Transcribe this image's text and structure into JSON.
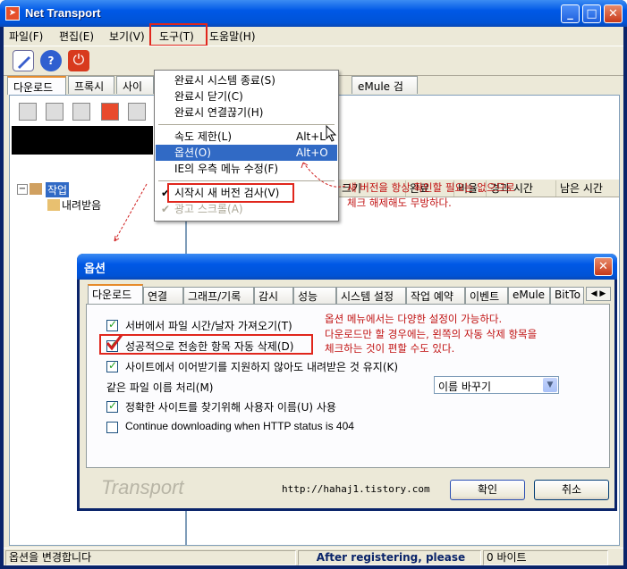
{
  "window": {
    "title": "Net Transport"
  },
  "menubar": [
    "파일(F)",
    "편집(E)",
    "보기(V)",
    "도구(T)",
    "도움말(H)"
  ],
  "main_tabs": [
    "다운로드",
    "프록시",
    "사이트"
  ],
  "emule_tab": "eMule 검색",
  "tools_menu": {
    "items": [
      {
        "label": "완료시 시스템 종료(S)",
        "shortcut": ""
      },
      {
        "label": "완료시 닫기(C)",
        "shortcut": ""
      },
      {
        "label": "완료시 연결끊기(H)",
        "shortcut": ""
      },
      {
        "label": "속도 제한(L)",
        "shortcut": "Alt+L"
      },
      {
        "label": "옵션(O)",
        "shortcut": "Alt+O"
      },
      {
        "label": "IE의 우측 메뉴 수정(F)",
        "shortcut": ""
      },
      {
        "label": "시작시 새 버전 검사(V)",
        "shortcut": ""
      },
      {
        "label": "광고 스크롤(A)",
        "shortcut": ""
      }
    ]
  },
  "tree": {
    "root": "작업",
    "child": "내려받음"
  },
  "columns": [
    "크기",
    "완료",
    "비율",
    "경과 시간",
    "남은 시간"
  ],
  "annotations": {
    "top_note_line1": "새 버전을 항상 확인할 필요는 없으므로",
    "top_note_line2": "체크 해제해도 무방하다.",
    "dlg_note_line1": "옵션 메뉴에서는 다양한 설정이 가능하다.",
    "dlg_note_line2": "다운로드만 할 경우에는, 왼쪽의 자동 삭제 항목을",
    "dlg_note_line3": "체크하는 것이 편할 수도 있다."
  },
  "options_dialog": {
    "title": "옵션",
    "tabs": [
      "다운로드",
      "연결",
      "그래프/기록",
      "감시",
      "성능",
      "시스템 설정",
      "작업 예약",
      "이벤트",
      "eMule",
      "BitTo"
    ],
    "options": [
      {
        "label": "서버에서 파일 시간/날자 가져오기(T)",
        "checked": true
      },
      {
        "label": "성공적으로 전송한 항목 자동 삭제(D)",
        "checked": true
      },
      {
        "label": "사이트에서 이어받기를 지원하지 않아도 내려받은 것 유지(K)",
        "checked": true
      },
      {
        "label": "정확한 사이트를 찾기위해 사용자 이름(U) 사용",
        "checked": true
      },
      {
        "label": "Continue downloading when HTTP status is 404",
        "checked": false
      }
    ],
    "same_name_label": "같은 파일 이름 처리(M)",
    "same_name_value": "이름 바꾸기",
    "brand": "Transport",
    "url": "http://hahaj1.tistory.com",
    "ok": "확인",
    "cancel": "취소"
  },
  "status": {
    "left": "옵션을 변경합니다",
    "middle": "After registering, please",
    "right": "0 바이트"
  },
  "colors": {
    "accent_red": "#e0261c",
    "highlight": "#316ac5",
    "xp_blue": "#0058e6"
  }
}
